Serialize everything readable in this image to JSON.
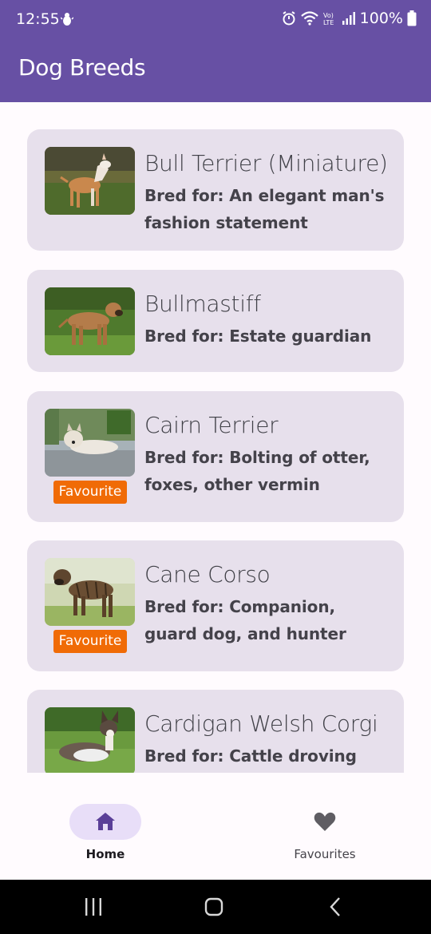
{
  "status_bar": {
    "time": "12:55",
    "battery": "100%",
    "icons": [
      "bug-icon",
      "alarm-icon",
      "wifi-icon",
      "volte-icon",
      "signal-icon",
      "battery-icon"
    ]
  },
  "app_bar": {
    "title": "Dog Breeds",
    "color": "#6750a4"
  },
  "breeds": [
    {
      "name": "Bull Terrier (Miniature)",
      "bred_for": "Bred for: An elegant man's fashion statement",
      "favourite": false
    },
    {
      "name": "Bullmastiff",
      "bred_for": "Bred for: Estate guardian",
      "favourite": false
    },
    {
      "name": "Cairn Terrier",
      "bred_for": "Bred for: Bolting of otter, foxes, other vermin",
      "favourite": true,
      "badge": "Favourite"
    },
    {
      "name": "Cane Corso",
      "bred_for": "Bred for: Companion, guard dog, and hunter",
      "favourite": true,
      "badge": "Favourite"
    },
    {
      "name": "Cardigan Welsh Corgi",
      "bred_for": "Bred for: Cattle droving",
      "favourite": false
    }
  ],
  "bottom_nav": {
    "items": [
      {
        "label": "Home",
        "icon": "home-icon",
        "selected": true
      },
      {
        "label": "Favourites",
        "icon": "heart-icon",
        "selected": false
      }
    ]
  },
  "colors": {
    "accent": "#6750a4",
    "card": "#e7e0ec",
    "badge": "#f06b06",
    "nav_pill": "#e8def8"
  }
}
